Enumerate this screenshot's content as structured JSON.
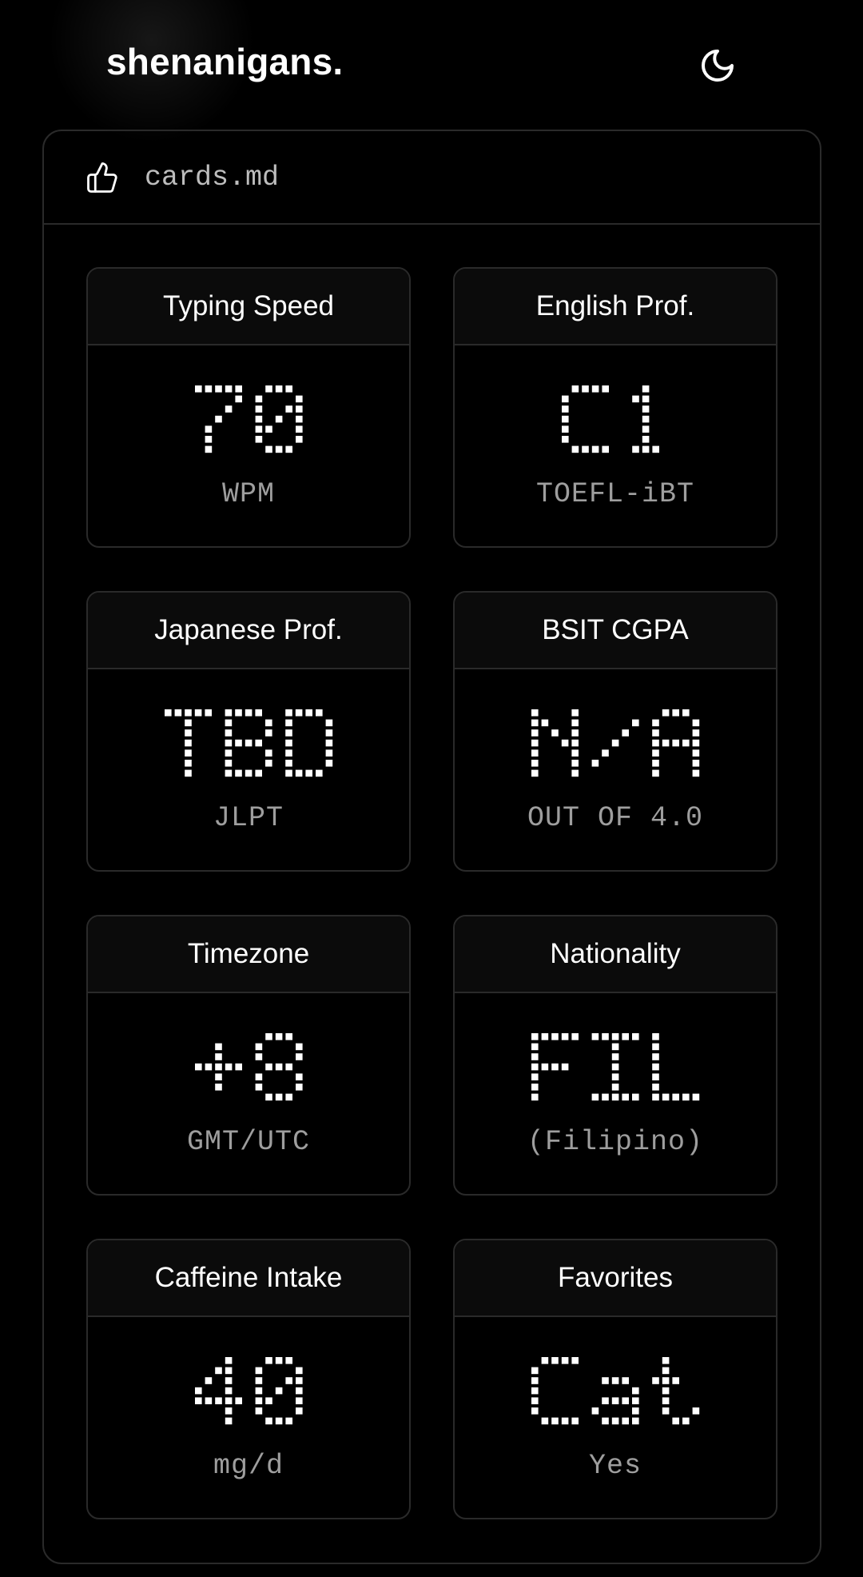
{
  "header": {
    "title": "shenanigans.",
    "theme_toggle_icon": "moon-icon"
  },
  "panel": {
    "icon": "thumbs-up-icon",
    "file_name": "cards.md"
  },
  "cards": [
    {
      "title": "Typing Speed",
      "value": "70",
      "unit": "WPM"
    },
    {
      "title": "English Prof.",
      "value": "C1",
      "unit": "TOEFL-iBT"
    },
    {
      "title": "Japanese Prof.",
      "value": "TBD",
      "unit": "JLPT"
    },
    {
      "title": "BSIT CGPA",
      "value": "N/A",
      "unit": "OUT OF 4.0"
    },
    {
      "title": "Timezone",
      "value": "+8",
      "unit": "GMT/UTC"
    },
    {
      "title": "Nationality",
      "value": "FIL",
      "unit": "(Filipino)"
    },
    {
      "title": "Caffeine Intake",
      "value": "40",
      "unit": "mg/d"
    },
    {
      "title": "Favorites",
      "value": "Cat",
      "unit": "Yes"
    }
  ],
  "colors": {
    "background": "#000000",
    "border": "#2a2a2a",
    "card_header": "#0b0b0b",
    "text": "#ffffff",
    "muted_text": "#9e9e9e"
  }
}
